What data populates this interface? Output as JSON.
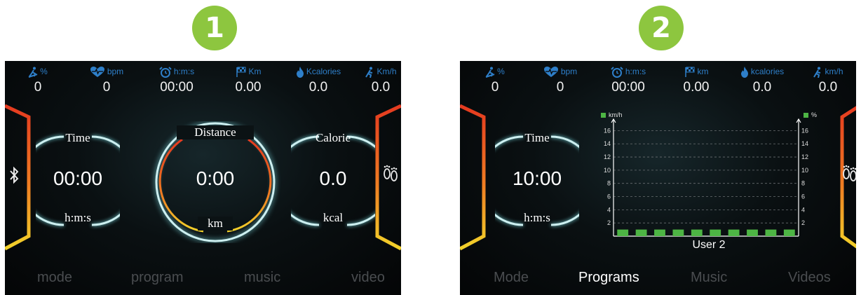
{
  "badges": [
    "1",
    "2"
  ],
  "screen1": {
    "stats": [
      {
        "unit": "%",
        "value": "0",
        "icon": "incline-runner-icon"
      },
      {
        "unit": "bpm",
        "value": "0",
        "icon": "heart-pulse-icon"
      },
      {
        "unit": "h:m:s",
        "value": "00:00",
        "icon": "alarm-clock-icon"
      },
      {
        "unit": "Km",
        "value": "0.00",
        "icon": "checkered-flag-icon"
      },
      {
        "unit": "Kcalories",
        "value": "0.0",
        "icon": "flame-icon"
      },
      {
        "unit": "Km/h",
        "value": "0.0",
        "icon": "runner-icon"
      }
    ],
    "time": {
      "label": "Time",
      "value": "00:00",
      "unit": "h:m:s"
    },
    "distance": {
      "label": "Distance",
      "value": "0:00",
      "unit": "km"
    },
    "calorie": {
      "label": "Calorie",
      "value": "0.0",
      "unit": "kcal"
    },
    "tabs": [
      "mode",
      "program",
      "music",
      "video"
    ],
    "left_icon": "bluetooth-icon",
    "right_icon": "footprints-icon"
  },
  "screen2": {
    "stats": [
      {
        "unit": "%",
        "value": "0",
        "icon": "incline-runner-icon"
      },
      {
        "unit": "bpm",
        "value": "0",
        "icon": "heart-pulse-icon"
      },
      {
        "unit": "h:m:s",
        "value": "00:00",
        "icon": "alarm-clock-icon"
      },
      {
        "unit": "km",
        "value": "0.00",
        "icon": "checkered-flag-icon"
      },
      {
        "unit": "kcalories",
        "value": "0.0",
        "icon": "flame-icon"
      },
      {
        "unit": "km/h",
        "value": "0.0",
        "icon": "runner-icon"
      }
    ],
    "time": {
      "label": "Time",
      "value": "10:00",
      "unit": "h:m:s"
    },
    "tabs": [
      "Mode",
      "Programs",
      "Music",
      "Videos"
    ],
    "active_tab": 1,
    "right_icon": "footprints-icon"
  },
  "chart_data": {
    "type": "bar",
    "title": "User 2",
    "left_axis_label": "km/h",
    "right_axis_label": "%",
    "left_ticks": [
      "2",
      "4",
      "6",
      "8",
      "10",
      "12",
      "14",
      "16"
    ],
    "right_ticks": [
      "2",
      "4",
      "6",
      "8",
      "10",
      "12",
      "14",
      "16"
    ],
    "ylim": [
      0,
      17
    ],
    "values": [
      1,
      1,
      1,
      1,
      1,
      1,
      1,
      1,
      1,
      1
    ],
    "bar_color": "#4db544",
    "grid": true
  },
  "colors": {
    "accent_blue": "#2e7fc9",
    "ring_cyan": "#cdeff0",
    "bracket_red": "#e53a20",
    "bracket_yellow": "#f2d22a",
    "badge_green": "#8dc63f"
  }
}
